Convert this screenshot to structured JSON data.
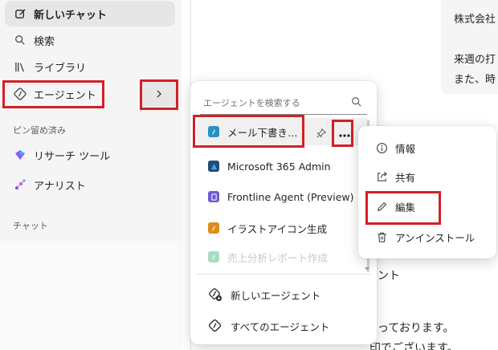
{
  "sidebar": {
    "new_chat": "新しいチャット",
    "search": "検索",
    "library": "ライブラリ",
    "agents": "エージェント",
    "pinned_label": "ピン留め済み",
    "pinned": [
      "リサーチ ツール",
      "アナリスト"
    ],
    "chat_label": "チャット"
  },
  "content": {
    "bubble_lines": [
      "株式会社",
      "",
      "来週の打",
      "また、時"
    ],
    "line1": "ント",
    "line2": "っております。",
    "line3": "印でございます。"
  },
  "agent_menu": {
    "search_placeholder": "エージェントを検索する",
    "items": [
      {
        "label": "メール下書き…",
        "icon": "mail-draft-icon",
        "color": "#2c8fc4"
      },
      {
        "label": "Microsoft 365 Admin",
        "icon": "m365-admin-icon",
        "color": "#1f4e79"
      },
      {
        "label": "Frontline Agent (Preview)",
        "icon": "frontline-icon",
        "color": "#6f5cd1"
      },
      {
        "label": "イラストアイコン生成",
        "icon": "illustration-icon",
        "color": "#e08a1e"
      },
      {
        "label": "売上分析レポート作成",
        "icon": "sales-report-icon",
        "color": "#3aa574"
      }
    ],
    "new_agent": "新しいエージェント",
    "all_agents": "すべてのエージェント"
  },
  "context_menu": {
    "items": [
      "情報",
      "共有",
      "編集",
      "アンインストール"
    ]
  },
  "colors": {
    "highlight_red": "#d32027",
    "sidebar_bg": "#f5f5f5"
  }
}
